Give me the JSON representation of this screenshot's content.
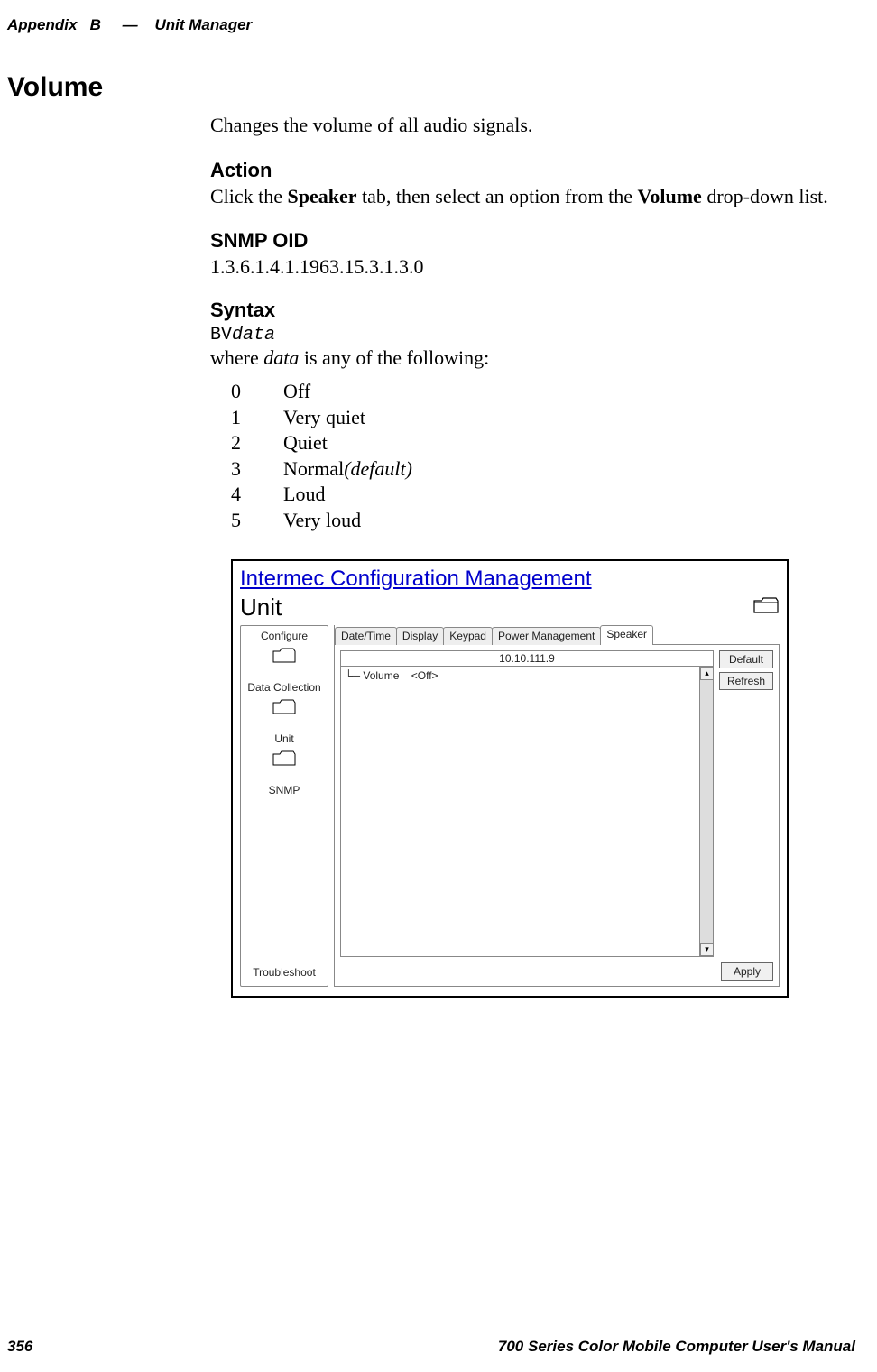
{
  "header": {
    "appendix_label": "Appendix",
    "appendix_letter": "B",
    "separator": "—",
    "title": "Unit Manager"
  },
  "section": {
    "heading": "Volume",
    "intro": "Changes the volume of all audio signals.",
    "action": {
      "heading": "Action",
      "pre": "Click the ",
      "bold1": "Speaker",
      "mid": " tab, then select an option from the ",
      "bold2": "Volume",
      "post": " drop-down list."
    },
    "snmp": {
      "heading": "SNMP OID",
      "value": "1.3.6.1.4.1.1963.15.3.1.3.0"
    },
    "syntax": {
      "heading": "Syntax",
      "code": "BVdata",
      "where_pre": "where ",
      "where_italic": "data",
      "where_post": " is any of the following:",
      "values": [
        {
          "idx": "0",
          "label": "Off",
          "note": ""
        },
        {
          "idx": "1",
          "label": "Very quiet",
          "note": ""
        },
        {
          "idx": "2",
          "label": "Quiet",
          "note": ""
        },
        {
          "idx": "3",
          "label": "Normal ",
          "note": "(default)"
        },
        {
          "idx": "4",
          "label": "Loud",
          "note": ""
        },
        {
          "idx": "5",
          "label": "Very loud",
          "note": ""
        }
      ]
    }
  },
  "screenshot": {
    "title": "Intermec Configuration Management",
    "section": "Unit",
    "sidebar": {
      "items": [
        {
          "label": "Configure"
        },
        {
          "label": "Data Collection"
        },
        {
          "label": "Unit"
        },
        {
          "label": "SNMP"
        }
      ],
      "bottom": "Troubleshoot"
    },
    "tabs": [
      {
        "label": "Date/Time"
      },
      {
        "label": "Display"
      },
      {
        "label": "Keypad"
      },
      {
        "label": "Power Management"
      },
      {
        "label": "Speaker"
      }
    ],
    "active_tab": 4,
    "tree": {
      "header": "10.10.111.9",
      "item_label": "Volume",
      "item_value": "<Off>"
    },
    "buttons": {
      "default": "Default",
      "refresh": "Refresh",
      "apply": "Apply"
    }
  },
  "footer": {
    "page_number": "356",
    "book_title": "700 Series Color Mobile Computer User's Manual"
  }
}
